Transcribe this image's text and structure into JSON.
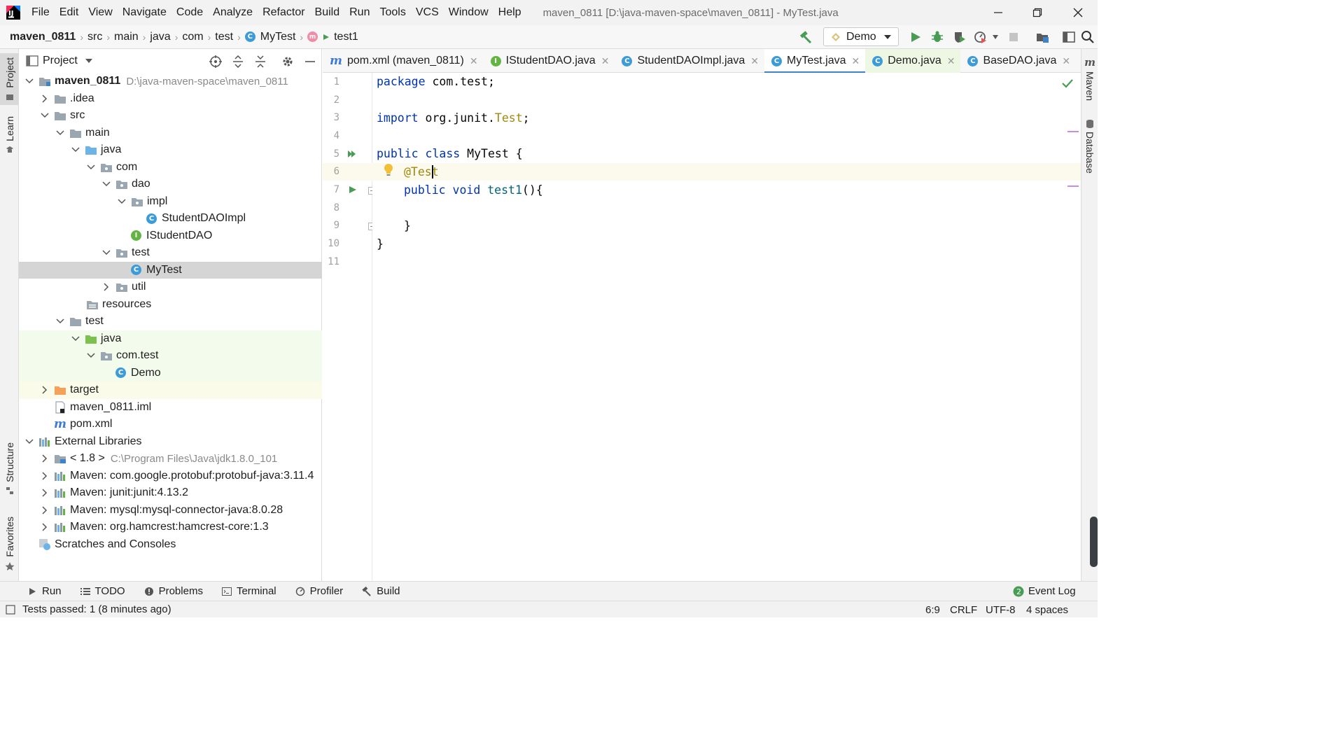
{
  "title_bar": {
    "window_title": "maven_0811 [D:\\java-maven-space\\maven_0811] - MyTest.java",
    "menu": [
      "File",
      "Edit",
      "View",
      "Navigate",
      "Code",
      "Analyze",
      "Refactor",
      "Build",
      "Run",
      "Tools",
      "VCS",
      "Window",
      "Help"
    ]
  },
  "breadcrumbs": [
    "maven_0811",
    "src",
    "main",
    "java",
    "com",
    "test",
    "MyTest",
    "test1"
  ],
  "toolbar": {
    "run_config": "Demo"
  },
  "left_stripe": {
    "project": "Project",
    "learn": "Learn",
    "structure": "Structure",
    "favorites": "Favorites"
  },
  "right_stripe": {
    "maven": "Maven",
    "database": "Database"
  },
  "project_panel": {
    "title": "Project",
    "tree": [
      {
        "label": "maven_0811",
        "path": "D:\\java-maven-space\\maven_0811"
      },
      {
        "label": ".idea"
      },
      {
        "label": "src"
      },
      {
        "label": "main"
      },
      {
        "label": "java"
      },
      {
        "label": "com"
      },
      {
        "label": "dao"
      },
      {
        "label": "impl"
      },
      {
        "label": "StudentDAOImpl"
      },
      {
        "label": "IStudentDAO"
      },
      {
        "label": "test"
      },
      {
        "label": "MyTest"
      },
      {
        "label": "util"
      },
      {
        "label": "resources"
      },
      {
        "label": "test"
      },
      {
        "label": "java"
      },
      {
        "label": "com.test"
      },
      {
        "label": "Demo"
      },
      {
        "label": "target"
      },
      {
        "label": "maven_0811.iml"
      },
      {
        "label": "pom.xml"
      },
      {
        "label": "External Libraries"
      },
      {
        "label": "< 1.8 >",
        "path": "C:\\Program Files\\Java\\jdk1.8.0_101"
      },
      {
        "label": "Maven: com.google.protobuf:protobuf-java:3.11.4"
      },
      {
        "label": "Maven: junit:junit:4.13.2"
      },
      {
        "label": "Maven: mysql:mysql-connector-java:8.0.28"
      },
      {
        "label": "Maven: org.hamcrest:hamcrest-core:1.3"
      },
      {
        "label": "Scratches and Consoles"
      }
    ]
  },
  "editor_tabs": [
    {
      "label": "pom.xml (maven_0811)",
      "badge": "m"
    },
    {
      "label": "IStudentDAO.java",
      "badge": "I"
    },
    {
      "label": "StudentDAOImpl.java",
      "badge": "C"
    },
    {
      "label": "MyTest.java",
      "badge": "C"
    },
    {
      "label": "Demo.java",
      "badge": "C"
    },
    {
      "label": "BaseDAO.java",
      "badge": "C"
    }
  ],
  "code": {
    "line_numbers": [
      "1",
      "2",
      "3",
      "4",
      "5",
      "6",
      "7",
      "8",
      "9",
      "10",
      "11"
    ],
    "l1_kw": "package",
    "l1_rest": " com.test;",
    "l3_kw": "import",
    "l3_rest": " org.junit.",
    "l3_type": "Test",
    "l3_end": ";",
    "l5_kw": "public class",
    "l5_rest": " MyTest {",
    "l6_ann": "@Test",
    "l7_kw": "public void",
    "l7_fn": " test1",
    "l7_rest": "(){",
    "l9": "}",
    "l10": "}"
  },
  "bottom_tools": [
    "Run",
    "TODO",
    "Problems",
    "Terminal",
    "Profiler",
    "Build"
  ],
  "event_log": "Event Log",
  "status": {
    "message": "Tests passed: 1 (8 minutes ago)",
    "position": "6:9",
    "line_sep": "CRLF",
    "encoding": "UTF-8",
    "indent": "4 spaces"
  },
  "colors": {
    "accent": "#4083c9",
    "keyword": "#0033b3",
    "annotation": "#9e880d",
    "run_green": "#499c54"
  }
}
